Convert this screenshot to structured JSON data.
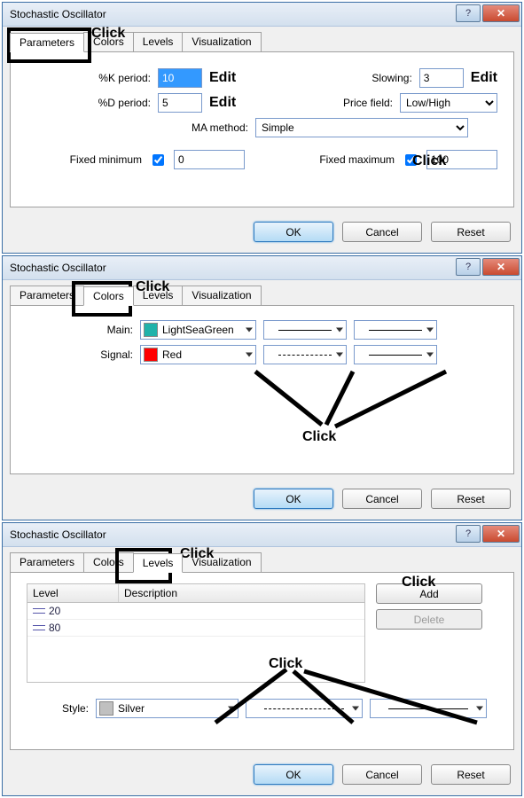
{
  "dialog_title": "Stochastic Oscillator",
  "tabs": {
    "parameters": "Parameters",
    "colors": "Colors",
    "levels": "Levels",
    "visualization": "Visualization"
  },
  "buttons": {
    "ok": "OK",
    "cancel": "Cancel",
    "reset": "Reset",
    "add": "Add",
    "delete": "Delete"
  },
  "annotations": {
    "click": "Click",
    "edit": "Edit"
  },
  "parameters": {
    "k_label": "%K period:",
    "k_value": "10",
    "d_label": "%D period:",
    "d_value": "5",
    "slowing_label": "Slowing:",
    "slowing_value": "3",
    "price_label": "Price field:",
    "price_value": "Low/High",
    "ma_label": "MA method:",
    "ma_value": "Simple",
    "fixed_min_label": "Fixed minimum",
    "fixed_min_value": "0",
    "fixed_max_label": "Fixed maximum",
    "fixed_max_value": "100"
  },
  "colors": {
    "main_label": "Main:",
    "main_color_name": "LightSeaGreen",
    "main_color_hex": "#20B2AA",
    "signal_label": "Signal:",
    "signal_color_name": "Red",
    "signal_color_hex": "#FF0000"
  },
  "levels": {
    "col_level": "Level",
    "col_desc": "Description",
    "rows": [
      {
        "level": "20",
        "desc": ""
      },
      {
        "level": "80",
        "desc": ""
      }
    ],
    "style_label": "Style:",
    "style_color_name": "Silver",
    "style_color_hex": "#C0C0C0"
  }
}
